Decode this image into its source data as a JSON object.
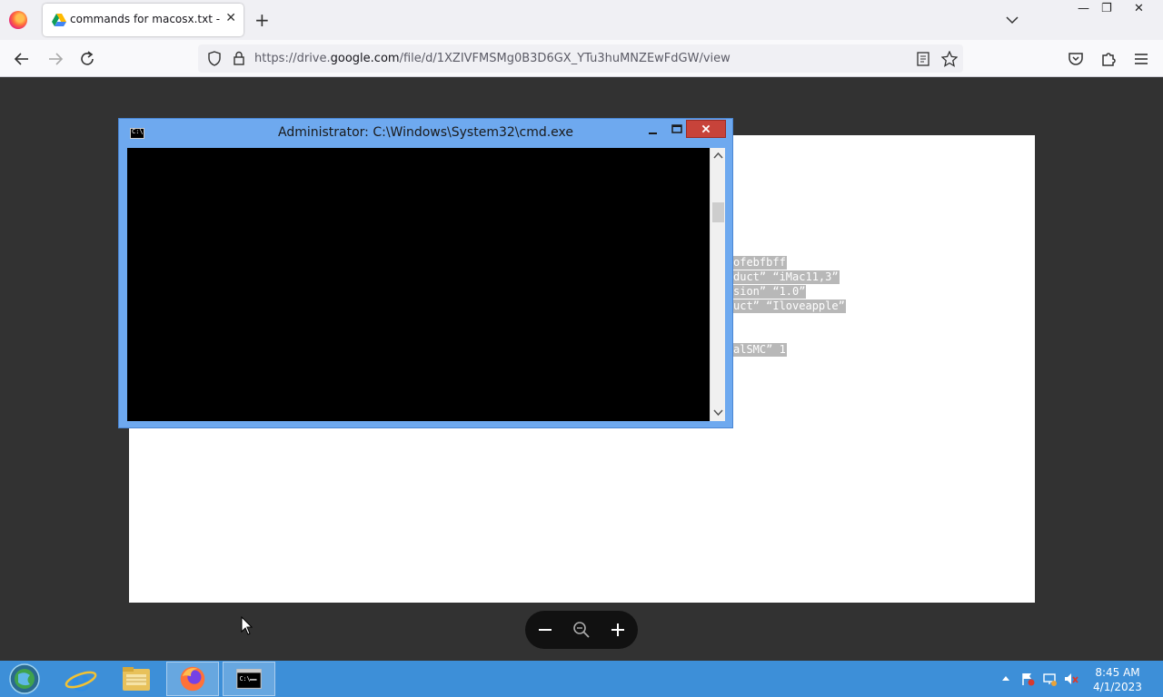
{
  "browser": {
    "tab_title": "commands for macosx.txt - Google Drive",
    "url_prefix": "https://drive.",
    "url_host": "google.com",
    "url_path": "/file/d/1XZIVFMSMg0B3D6GX_YTu3huMNZEwFdGW/view"
  },
  "document": {
    "visible_lines": [
      "ofebfbff",
      "duct” “iMac11,3”",
      "sion” “1.0”",
      "uct” “Iloveapple”",
      "alSMC” 1"
    ]
  },
  "cmd_window": {
    "title": "Administrator: C:\\Windows\\System32\\cmd.exe",
    "icon_text": "C:\\"
  },
  "taskbar": {
    "time": "8:45 AM",
    "date": "4/1/2023",
    "apps": [
      "start-orb",
      "internet-explorer",
      "file-explorer",
      "firefox",
      "command-prompt"
    ]
  },
  "colors": {
    "cmd_titlebar": "#6ea9ef",
    "taskbar": "#3d8fd8",
    "viewer_bg": "#323232"
  }
}
